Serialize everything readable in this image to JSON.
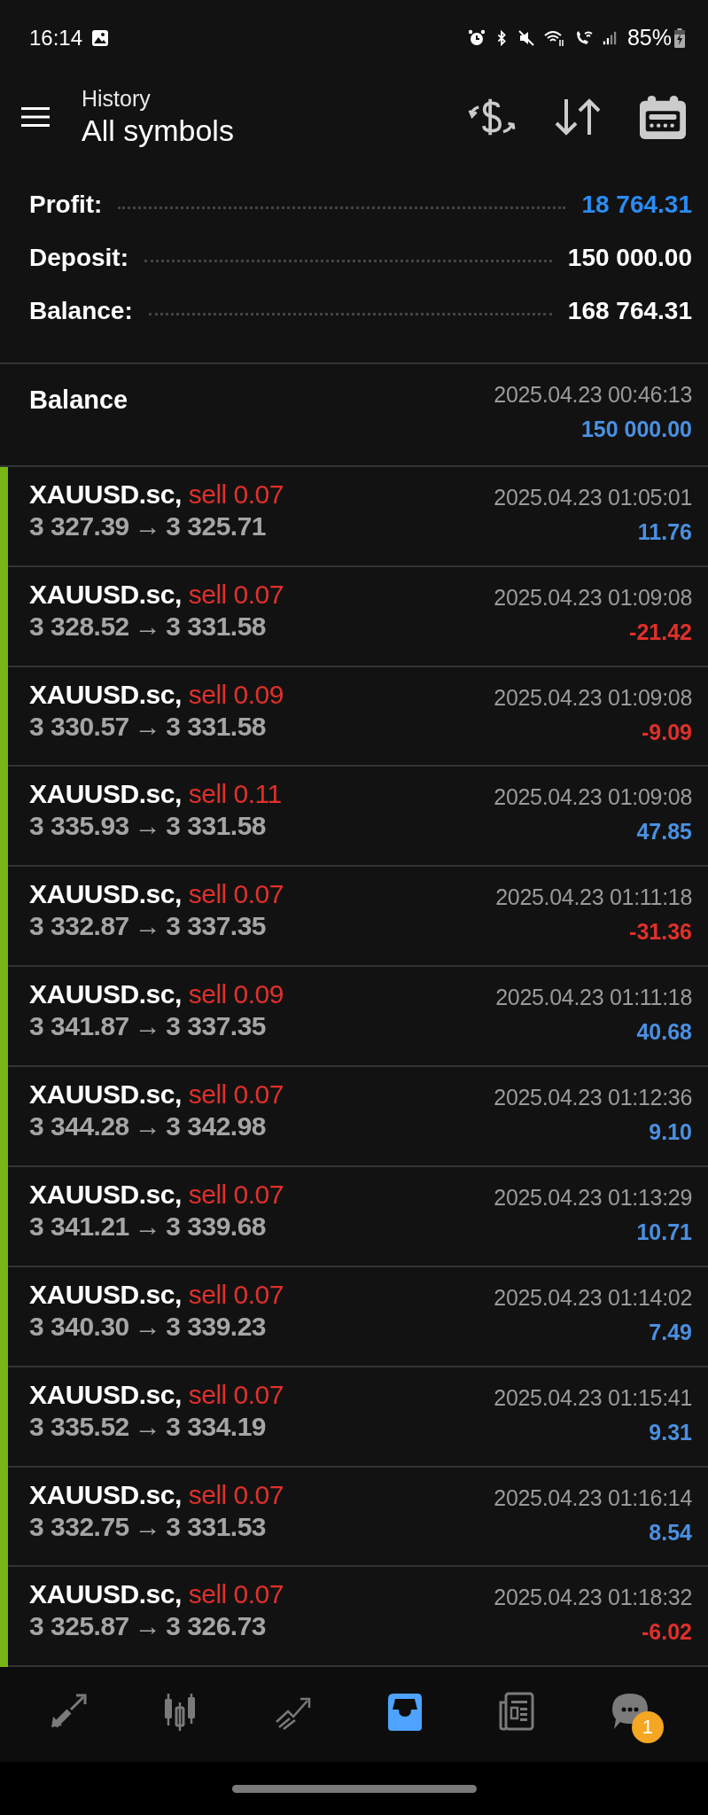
{
  "status_bar": {
    "time": "16:14",
    "battery": "85%"
  },
  "header": {
    "subtitle": "History",
    "title": "All symbols"
  },
  "summary": [
    {
      "label": "Profit:",
      "value": "18 764.31",
      "highlight": true
    },
    {
      "label": "Deposit:",
      "value": "150 000.00",
      "highlight": false
    },
    {
      "label": "Balance:",
      "value": "168 764.31",
      "highlight": false
    }
  ],
  "balance_entry": {
    "label": "Balance",
    "time": "2025.04.23 00:46:13",
    "amount": "150 000.00"
  },
  "trades": [
    {
      "symbol": "XAUUSD.sc,",
      "side": "sell 0.07",
      "open": "3 327.39",
      "arrow": "→",
      "close": "3 325.71",
      "time": "2025.04.23 01:05:01",
      "profit": "11.76",
      "color": "#4a90e2"
    },
    {
      "symbol": "XAUUSD.sc,",
      "side": "sell 0.07",
      "open": "3 328.52",
      "arrow": "→",
      "close": "3 331.58",
      "time": "2025.04.23 01:09:08",
      "profit": "-21.42",
      "color": "#e0302a"
    },
    {
      "symbol": "XAUUSD.sc,",
      "side": "sell 0.09",
      "open": "3 330.57",
      "arrow": "→",
      "close": "3 331.58",
      "time": "2025.04.23 01:09:08",
      "profit": "-9.09",
      "color": "#e0302a"
    },
    {
      "symbol": "XAUUSD.sc,",
      "side": "sell 0.11",
      "open": "3 335.93",
      "arrow": "→",
      "close": "3 331.58",
      "time": "2025.04.23 01:09:08",
      "profit": "47.85",
      "color": "#4a90e2"
    },
    {
      "symbol": "XAUUSD.sc,",
      "side": "sell 0.07",
      "open": "3 332.87",
      "arrow": "→",
      "close": "3 337.35",
      "time": "2025.04.23 01:11:18",
      "profit": "-31.36",
      "color": "#e0302a"
    },
    {
      "symbol": "XAUUSD.sc,",
      "side": "sell 0.09",
      "open": "3 341.87",
      "arrow": "→",
      "close": "3 337.35",
      "time": "2025.04.23 01:11:18",
      "profit": "40.68",
      "color": "#4a90e2"
    },
    {
      "symbol": "XAUUSD.sc,",
      "side": "sell 0.07",
      "open": "3 344.28",
      "arrow": "→",
      "close": "3 342.98",
      "time": "2025.04.23 01:12:36",
      "profit": "9.10",
      "color": "#4a90e2"
    },
    {
      "symbol": "XAUUSD.sc,",
      "side": "sell 0.07",
      "open": "3 341.21",
      "arrow": "→",
      "close": "3 339.68",
      "time": "2025.04.23 01:13:29",
      "profit": "10.71",
      "color": "#4a90e2"
    },
    {
      "symbol": "XAUUSD.sc,",
      "side": "sell 0.07",
      "open": "3 340.30",
      "arrow": "→",
      "close": "3 339.23",
      "time": "2025.04.23 01:14:02",
      "profit": "7.49",
      "color": "#4a90e2"
    },
    {
      "symbol": "XAUUSD.sc,",
      "side": "sell 0.07",
      "open": "3 335.52",
      "arrow": "→",
      "close": "3 334.19",
      "time": "2025.04.23 01:15:41",
      "profit": "9.31",
      "color": "#4a90e2"
    },
    {
      "symbol": "XAUUSD.sc,",
      "side": "sell 0.07",
      "open": "3 332.75",
      "arrow": "→",
      "close": "3 331.53",
      "time": "2025.04.23 01:16:14",
      "profit": "8.54",
      "color": "#4a90e2"
    },
    {
      "symbol": "XAUUSD.sc,",
      "side": "sell 0.07",
      "open": "3 325.87",
      "arrow": "→",
      "close": "3 326.73",
      "time": "2025.04.23 01:18:32",
      "profit": "-6.02",
      "color": "#e0302a"
    }
  ],
  "bottom_nav": [
    {
      "kind": "quotes",
      "selected": false
    },
    {
      "kind": "chart",
      "selected": false
    },
    {
      "kind": "trade",
      "selected": false
    },
    {
      "kind": "history",
      "selected": true
    },
    {
      "kind": "news",
      "selected": false
    },
    {
      "kind": "chat",
      "selected": false,
      "badge": "1"
    }
  ]
}
